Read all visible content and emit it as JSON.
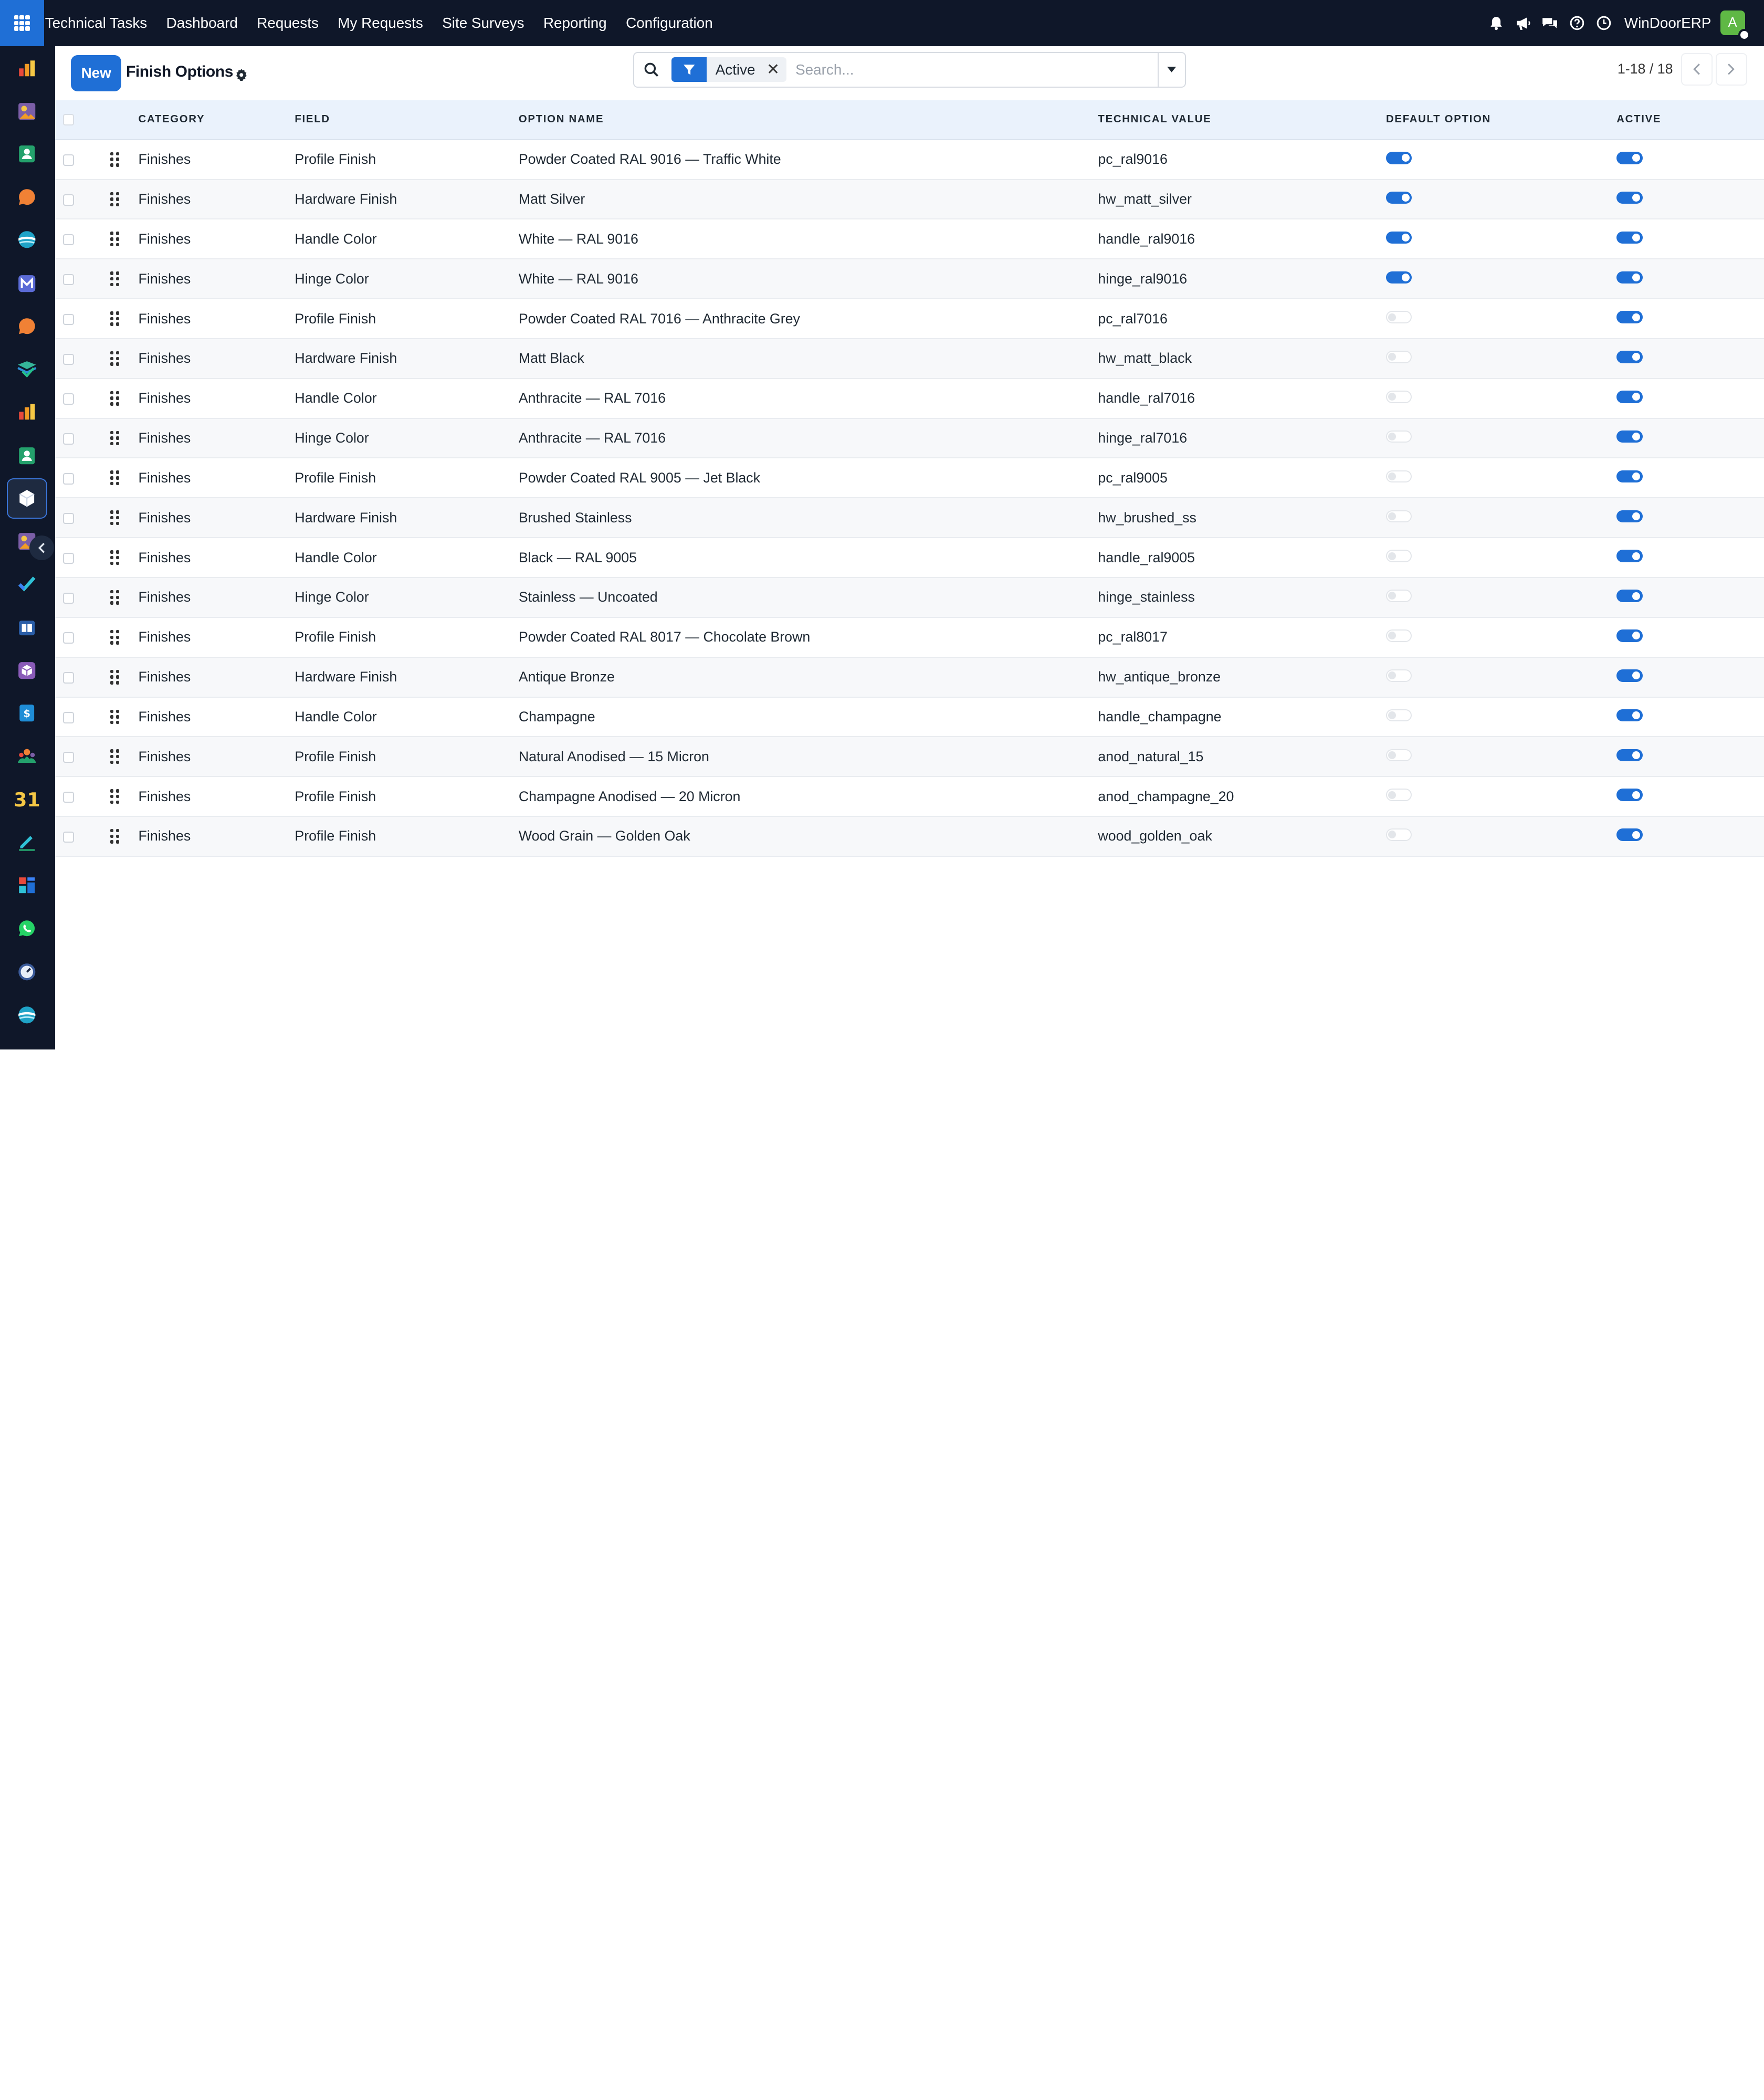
{
  "topbar": {
    "app_name": "Technical Tasks",
    "menu": [
      "Dashboard",
      "Requests",
      "My Requests",
      "Site Surveys",
      "Reporting",
      "Configuration"
    ],
    "company": "WinDoorERP",
    "avatar_letter": "A"
  },
  "sidebar": {
    "apps": [
      "chart-bars-icon",
      "photo-app-icon",
      "contacts-icon",
      "chat-bubble-icon",
      "planet-icon",
      "mail-m-icon",
      "chat-bubble-icon",
      "check-stack-icon",
      "chart-bars-icon",
      "contacts-icon",
      "cube-icon",
      "photo-app-icon",
      "checkmark-icon",
      "book-icon",
      "package-icon",
      "invoice-dollar-icon",
      "team-icon",
      "calendar-31-icon",
      "sign-pen-icon",
      "dashboard-blocks-icon",
      "whatsapp-icon",
      "gauge-icon",
      "planet-icon"
    ],
    "active_index": 10,
    "colors": {
      "background": "#0f1729",
      "active_border": "#3a74d8"
    }
  },
  "control_panel": {
    "new_label": "New",
    "title": "Finish Options",
    "facet_label": "Active",
    "search_placeholder": "Search...",
    "pager_value": "1-18 / 18"
  },
  "table": {
    "columns": [
      "Category",
      "Field",
      "Option Name",
      "Technical Value",
      "Default Option",
      "Active"
    ],
    "rows": [
      {
        "category": "Finishes",
        "field": "Profile Finish",
        "option_name": "Powder Coated RAL 9016 — Traffic White",
        "technical_value": "pc_ral9016",
        "default": true,
        "active": true
      },
      {
        "category": "Finishes",
        "field": "Hardware Finish",
        "option_name": "Matt Silver",
        "technical_value": "hw_matt_silver",
        "default": true,
        "active": true
      },
      {
        "category": "Finishes",
        "field": "Handle Color",
        "option_name": "White — RAL 9016",
        "technical_value": "handle_ral9016",
        "default": true,
        "active": true
      },
      {
        "category": "Finishes",
        "field": "Hinge Color",
        "option_name": "White — RAL 9016",
        "technical_value": "hinge_ral9016",
        "default": true,
        "active": true
      },
      {
        "category": "Finishes",
        "field": "Profile Finish",
        "option_name": "Powder Coated RAL 7016 — Anthracite Grey",
        "technical_value": "pc_ral7016",
        "default": false,
        "active": true
      },
      {
        "category": "Finishes",
        "field": "Hardware Finish",
        "option_name": "Matt Black",
        "technical_value": "hw_matt_black",
        "default": false,
        "active": true
      },
      {
        "category": "Finishes",
        "field": "Handle Color",
        "option_name": "Anthracite — RAL 7016",
        "technical_value": "handle_ral7016",
        "default": false,
        "active": true
      },
      {
        "category": "Finishes",
        "field": "Hinge Color",
        "option_name": "Anthracite — RAL 7016",
        "technical_value": "hinge_ral7016",
        "default": false,
        "active": true
      },
      {
        "category": "Finishes",
        "field": "Profile Finish",
        "option_name": "Powder Coated RAL 9005 — Jet Black",
        "technical_value": "pc_ral9005",
        "default": false,
        "active": true
      },
      {
        "category": "Finishes",
        "field": "Hardware Finish",
        "option_name": "Brushed Stainless",
        "technical_value": "hw_brushed_ss",
        "default": false,
        "active": true
      },
      {
        "category": "Finishes",
        "field": "Handle Color",
        "option_name": "Black — RAL 9005",
        "technical_value": "handle_ral9005",
        "default": false,
        "active": true
      },
      {
        "category": "Finishes",
        "field": "Hinge Color",
        "option_name": "Stainless — Uncoated",
        "technical_value": "hinge_stainless",
        "default": false,
        "active": true
      },
      {
        "category": "Finishes",
        "field": "Profile Finish",
        "option_name": "Powder Coated RAL 8017 — Chocolate Brown",
        "technical_value": "pc_ral8017",
        "default": false,
        "active": true
      },
      {
        "category": "Finishes",
        "field": "Hardware Finish",
        "option_name": "Antique Bronze",
        "technical_value": "hw_antique_bronze",
        "default": false,
        "active": true
      },
      {
        "category": "Finishes",
        "field": "Handle Color",
        "option_name": "Champagne",
        "technical_value": "handle_champagne",
        "default": false,
        "active": true
      },
      {
        "category": "Finishes",
        "field": "Profile Finish",
        "option_name": "Natural Anodised — 15 Micron",
        "technical_value": "anod_natural_15",
        "default": false,
        "active": true
      },
      {
        "category": "Finishes",
        "field": "Profile Finish",
        "option_name": "Champagne Anodised — 20 Micron",
        "technical_value": "anod_champagne_20",
        "default": false,
        "active": true
      },
      {
        "category": "Finishes",
        "field": "Profile Finish",
        "option_name": "Wood Grain — Golden Oak",
        "technical_value": "wood_golden_oak",
        "default": false,
        "active": true
      }
    ]
  },
  "colors": {
    "accent": "#1f6fd6",
    "topbar": "#0f1729",
    "header_row": "#eaf2fc",
    "avatar": "#5fb845"
  }
}
